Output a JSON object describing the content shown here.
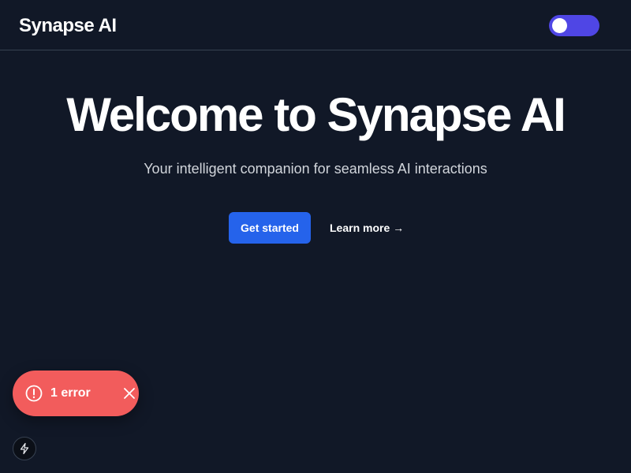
{
  "header": {
    "brand": "Synapse AI",
    "theme_toggle": {
      "state": "on",
      "accent_color": "#4f46e5"
    }
  },
  "hero": {
    "title": "Welcome to Synapse AI",
    "subtitle": "Your intelligent companion for seamless AI interactions",
    "primary_cta": "Get started",
    "secondary_cta": "Learn more →"
  },
  "error_toast": {
    "label": "1 error",
    "icon": "alert-circle-icon",
    "close_icon": "close-icon",
    "color": "#f25c5c"
  },
  "devtools": {
    "icon": "lightning-bolt-icon"
  },
  "colors": {
    "background": "#111827",
    "primary_button": "#2563eb",
    "subtitle_text": "#d1d5db",
    "divider": "#374151"
  }
}
